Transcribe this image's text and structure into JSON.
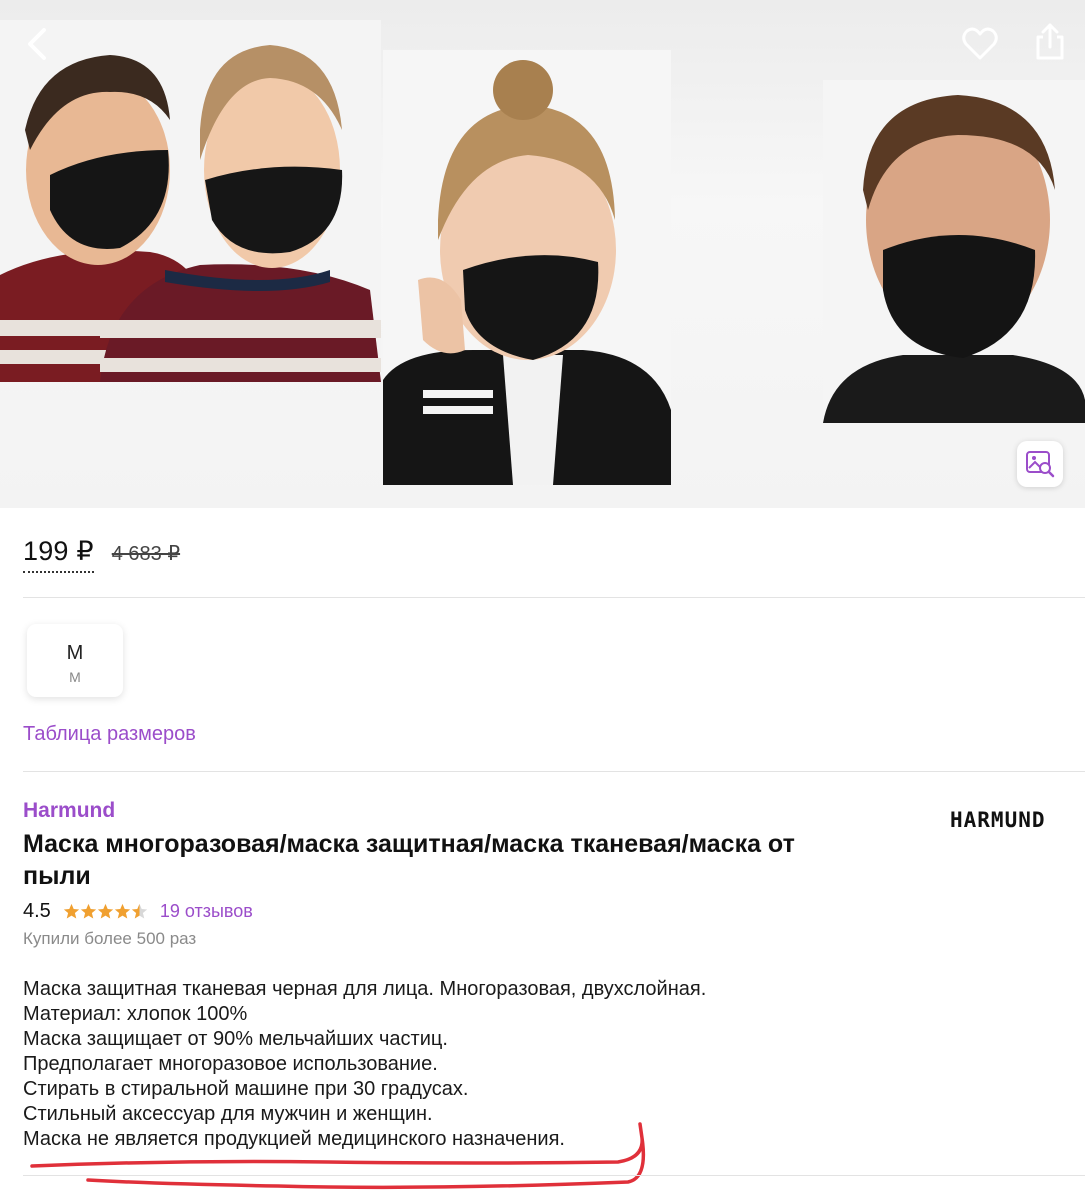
{
  "gallery": {
    "photos": [
      "couple-masks-photo",
      "woman-mask-photo",
      "man-mask-photo"
    ]
  },
  "price": {
    "current": "199 ₽",
    "old": "4 683 ₽"
  },
  "size": {
    "main": "M",
    "sub": "M",
    "table_link": "Таблица размеров"
  },
  "product": {
    "brand": "Harmund",
    "logo_text": "HARMUND",
    "title": "Маска многоразовая/маска защитная/маска тканевая/маска от пыли",
    "rating": "4.5",
    "rating_value": 4.5,
    "reviews": "19 отзывов",
    "bought": "Купили более 500 раз",
    "description": [
      "Маска защитная тканевая черная для лица. Многоразовая, двухслойная.",
      "Материал: хлопок 100%",
      "Маска защищает от 90% мельчайших частиц.",
      "Предполагает многоразовое использование.",
      "Стирать в стиральной машине при 30 градусах.",
      "Стильный аксессуар для мужчин и женщин.",
      "Маска не является продукцией медицинского назначения."
    ]
  },
  "colors": {
    "accent": "#9b4dca",
    "star": "#f0a030",
    "annotation": "#e0303a"
  },
  "icons": [
    "back-arrow-icon",
    "heart-icon",
    "share-icon",
    "image-search-icon",
    "star-icon"
  ]
}
